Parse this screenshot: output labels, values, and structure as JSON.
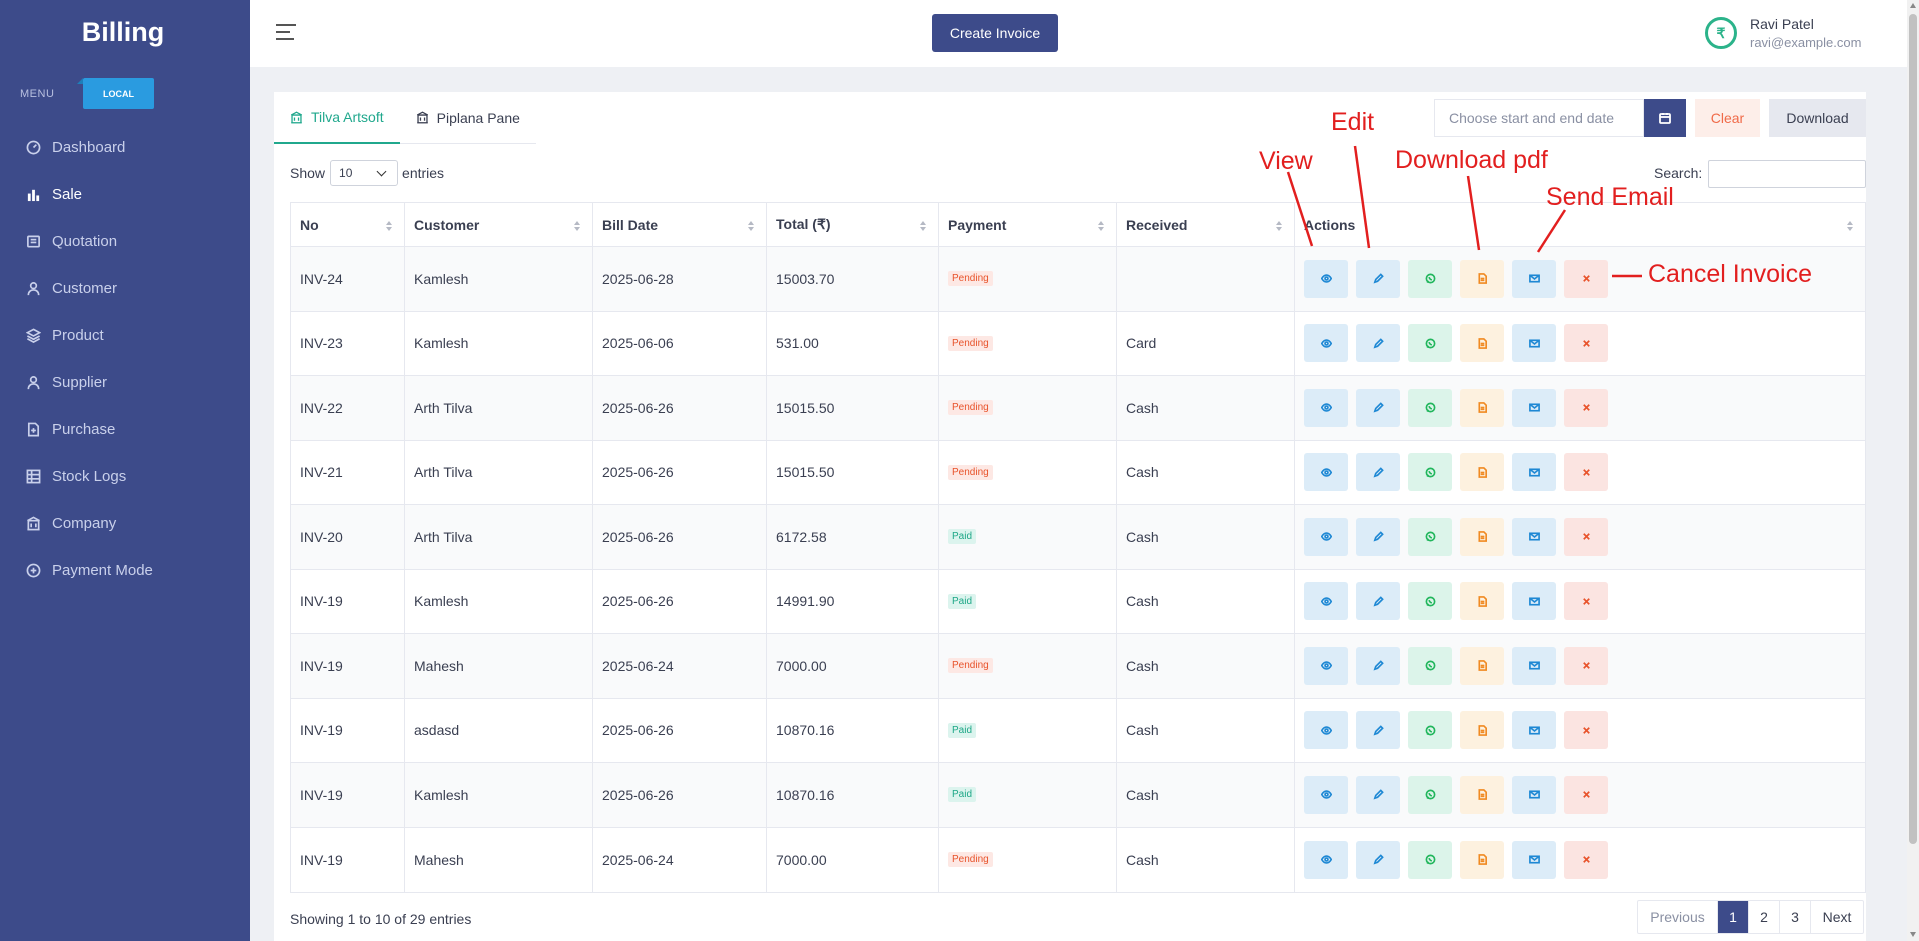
{
  "sidebar": {
    "brand": "Billing",
    "menu_label": "MENU",
    "env_badge": "LOCAL",
    "items": [
      {
        "label": "Dashboard",
        "icon": "dashboard-icon"
      },
      {
        "label": "Sale",
        "icon": "bar-chart-icon",
        "active": true
      },
      {
        "label": "Quotation",
        "icon": "document-icon"
      },
      {
        "label": "Customer",
        "icon": "user-icon"
      },
      {
        "label": "Product",
        "icon": "layers-icon"
      },
      {
        "label": "Supplier",
        "icon": "user-icon"
      },
      {
        "label": "Purchase",
        "icon": "file-plus-icon"
      },
      {
        "label": "Stock Logs",
        "icon": "grid-icon"
      },
      {
        "label": "Company",
        "icon": "building-icon"
      },
      {
        "label": "Payment Mode",
        "icon": "payment-icon"
      }
    ]
  },
  "topbar": {
    "create_invoice_label": "Create Invoice",
    "user_name": "Ravi Patel",
    "user_email": "ravi@example.com",
    "avatar_glyph": "₹"
  },
  "tabs": [
    {
      "label": "Tilva Artsoft",
      "active": true
    },
    {
      "label": "Piplana Pane",
      "active": false
    }
  ],
  "filters": {
    "date_placeholder": "Choose start and end date",
    "clear_label": "Clear",
    "download_label": "Download"
  },
  "table_controls": {
    "show_label": "Show",
    "entries_value": "10",
    "entries_label": "entries",
    "search_label": "Search:"
  },
  "table": {
    "columns": [
      "No",
      "Customer",
      "Bill Date",
      "Total (₹)",
      "Payment",
      "Received",
      "Actions"
    ],
    "rows": [
      {
        "no": "INV-24",
        "customer": "Kamlesh",
        "date": "2025-06-28",
        "total": "15003.70",
        "payment": "Pending",
        "received": ""
      },
      {
        "no": "INV-23",
        "customer": "Kamlesh",
        "date": "2025-06-06",
        "total": "531.00",
        "payment": "Pending",
        "received": "Card"
      },
      {
        "no": "INV-22",
        "customer": "Arth Tilva",
        "date": "2025-06-26",
        "total": "15015.50",
        "payment": "Pending",
        "received": "Cash"
      },
      {
        "no": "INV-21",
        "customer": "Arth Tilva",
        "date": "2025-06-26",
        "total": "15015.50",
        "payment": "Pending",
        "received": "Cash"
      },
      {
        "no": "INV-20",
        "customer": "Arth Tilva",
        "date": "2025-06-26",
        "total": "6172.58",
        "payment": "Paid",
        "received": "Cash"
      },
      {
        "no": "INV-19",
        "customer": "Kamlesh",
        "date": "2025-06-26",
        "total": "14991.90",
        "payment": "Paid",
        "received": "Cash"
      },
      {
        "no": "INV-19",
        "customer": "Mahesh",
        "date": "2025-06-24",
        "total": "7000.00",
        "payment": "Pending",
        "received": "Cash"
      },
      {
        "no": "INV-19",
        "customer": "asdasd",
        "date": "2025-06-26",
        "total": "10870.16",
        "payment": "Paid",
        "received": "Cash"
      },
      {
        "no": "INV-19",
        "customer": "Kamlesh",
        "date": "2025-06-26",
        "total": "10870.16",
        "payment": "Paid",
        "received": "Cash"
      },
      {
        "no": "INV-19",
        "customer": "Mahesh",
        "date": "2025-06-24",
        "total": "7000.00",
        "payment": "Pending",
        "received": "Cash"
      }
    ]
  },
  "footer": {
    "showing": "Showing 1 to 10 of 29 entries",
    "pagination": {
      "previous": "Previous",
      "pages": [
        "1",
        "2",
        "3"
      ],
      "current": "1",
      "next": "Next"
    }
  },
  "annotations": {
    "view": "View",
    "edit": "Edit",
    "download_pdf": "Download pdf",
    "send_email": "Send Email",
    "cancel_invoice": "Cancel Invoice",
    "color": "#e21f1f"
  },
  "colors": {
    "sidebar": "#3d4b8a",
    "accent_tab": "#20a88d",
    "pending": "#e8532b",
    "paid": "#1ea787"
  }
}
